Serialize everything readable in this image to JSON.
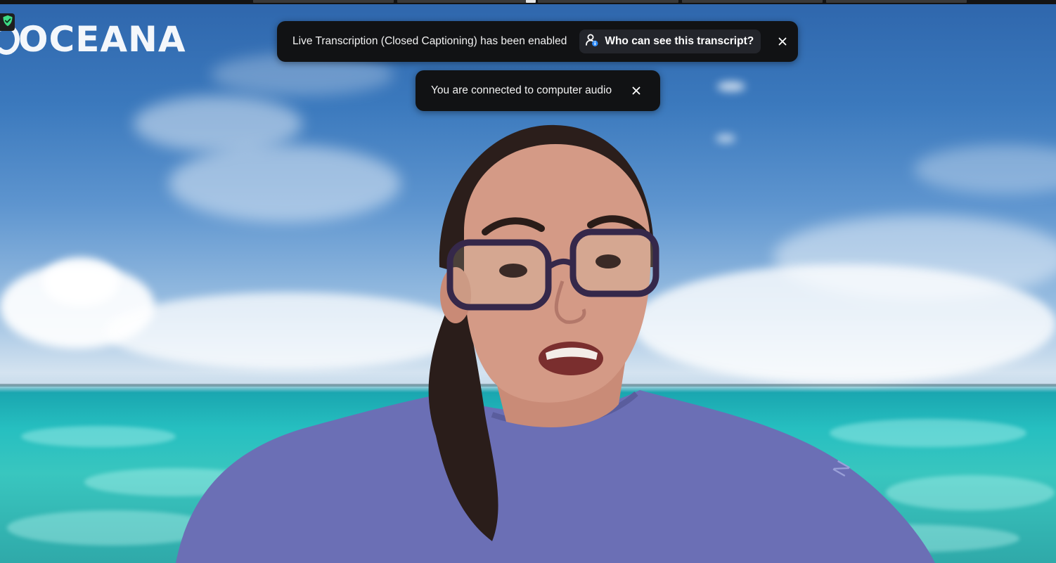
{
  "meeting": {
    "background_brand": "OCEANA",
    "security_icon": "shield-check-icon"
  },
  "notifications": {
    "transcription": {
      "message": "Live Transcription (Closed Captioning) has been enabled",
      "action_label": "Who can see this transcript?",
      "action_icon": "person-info-icon",
      "close_icon": "close-icon"
    },
    "audio": {
      "message": "You are connected to computer audio",
      "close_icon": "close-icon"
    }
  },
  "colors": {
    "toast_bg": "#111214",
    "action_bg": "#23252b",
    "shield_green": "#3ddc84",
    "person_badge_blue": "#2d8cff"
  }
}
